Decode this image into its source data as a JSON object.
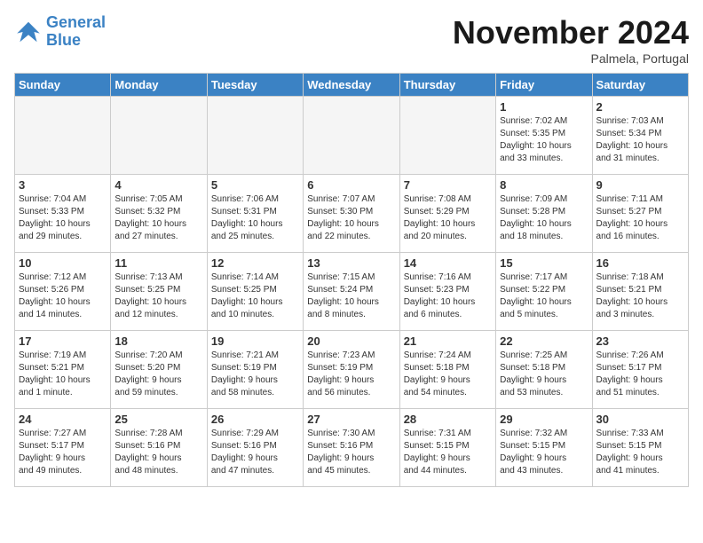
{
  "header": {
    "logo_line1": "General",
    "logo_line2": "Blue",
    "month": "November 2024",
    "location": "Palmela, Portugal"
  },
  "weekdays": [
    "Sunday",
    "Monday",
    "Tuesday",
    "Wednesday",
    "Thursday",
    "Friday",
    "Saturday"
  ],
  "weeks": [
    [
      {
        "day": "",
        "info": ""
      },
      {
        "day": "",
        "info": ""
      },
      {
        "day": "",
        "info": ""
      },
      {
        "day": "",
        "info": ""
      },
      {
        "day": "",
        "info": ""
      },
      {
        "day": "1",
        "info": "Sunrise: 7:02 AM\nSunset: 5:35 PM\nDaylight: 10 hours\nand 33 minutes."
      },
      {
        "day": "2",
        "info": "Sunrise: 7:03 AM\nSunset: 5:34 PM\nDaylight: 10 hours\nand 31 minutes."
      }
    ],
    [
      {
        "day": "3",
        "info": "Sunrise: 7:04 AM\nSunset: 5:33 PM\nDaylight: 10 hours\nand 29 minutes."
      },
      {
        "day": "4",
        "info": "Sunrise: 7:05 AM\nSunset: 5:32 PM\nDaylight: 10 hours\nand 27 minutes."
      },
      {
        "day": "5",
        "info": "Sunrise: 7:06 AM\nSunset: 5:31 PM\nDaylight: 10 hours\nand 25 minutes."
      },
      {
        "day": "6",
        "info": "Sunrise: 7:07 AM\nSunset: 5:30 PM\nDaylight: 10 hours\nand 22 minutes."
      },
      {
        "day": "7",
        "info": "Sunrise: 7:08 AM\nSunset: 5:29 PM\nDaylight: 10 hours\nand 20 minutes."
      },
      {
        "day": "8",
        "info": "Sunrise: 7:09 AM\nSunset: 5:28 PM\nDaylight: 10 hours\nand 18 minutes."
      },
      {
        "day": "9",
        "info": "Sunrise: 7:11 AM\nSunset: 5:27 PM\nDaylight: 10 hours\nand 16 minutes."
      }
    ],
    [
      {
        "day": "10",
        "info": "Sunrise: 7:12 AM\nSunset: 5:26 PM\nDaylight: 10 hours\nand 14 minutes."
      },
      {
        "day": "11",
        "info": "Sunrise: 7:13 AM\nSunset: 5:25 PM\nDaylight: 10 hours\nand 12 minutes."
      },
      {
        "day": "12",
        "info": "Sunrise: 7:14 AM\nSunset: 5:25 PM\nDaylight: 10 hours\nand 10 minutes."
      },
      {
        "day": "13",
        "info": "Sunrise: 7:15 AM\nSunset: 5:24 PM\nDaylight: 10 hours\nand 8 minutes."
      },
      {
        "day": "14",
        "info": "Sunrise: 7:16 AM\nSunset: 5:23 PM\nDaylight: 10 hours\nand 6 minutes."
      },
      {
        "day": "15",
        "info": "Sunrise: 7:17 AM\nSunset: 5:22 PM\nDaylight: 10 hours\nand 5 minutes."
      },
      {
        "day": "16",
        "info": "Sunrise: 7:18 AM\nSunset: 5:21 PM\nDaylight: 10 hours\nand 3 minutes."
      }
    ],
    [
      {
        "day": "17",
        "info": "Sunrise: 7:19 AM\nSunset: 5:21 PM\nDaylight: 10 hours\nand 1 minute."
      },
      {
        "day": "18",
        "info": "Sunrise: 7:20 AM\nSunset: 5:20 PM\nDaylight: 9 hours\nand 59 minutes."
      },
      {
        "day": "19",
        "info": "Sunrise: 7:21 AM\nSunset: 5:19 PM\nDaylight: 9 hours\nand 58 minutes."
      },
      {
        "day": "20",
        "info": "Sunrise: 7:23 AM\nSunset: 5:19 PM\nDaylight: 9 hours\nand 56 minutes."
      },
      {
        "day": "21",
        "info": "Sunrise: 7:24 AM\nSunset: 5:18 PM\nDaylight: 9 hours\nand 54 minutes."
      },
      {
        "day": "22",
        "info": "Sunrise: 7:25 AM\nSunset: 5:18 PM\nDaylight: 9 hours\nand 53 minutes."
      },
      {
        "day": "23",
        "info": "Sunrise: 7:26 AM\nSunset: 5:17 PM\nDaylight: 9 hours\nand 51 minutes."
      }
    ],
    [
      {
        "day": "24",
        "info": "Sunrise: 7:27 AM\nSunset: 5:17 PM\nDaylight: 9 hours\nand 49 minutes."
      },
      {
        "day": "25",
        "info": "Sunrise: 7:28 AM\nSunset: 5:16 PM\nDaylight: 9 hours\nand 48 minutes."
      },
      {
        "day": "26",
        "info": "Sunrise: 7:29 AM\nSunset: 5:16 PM\nDaylight: 9 hours\nand 47 minutes."
      },
      {
        "day": "27",
        "info": "Sunrise: 7:30 AM\nSunset: 5:16 PM\nDaylight: 9 hours\nand 45 minutes."
      },
      {
        "day": "28",
        "info": "Sunrise: 7:31 AM\nSunset: 5:15 PM\nDaylight: 9 hours\nand 44 minutes."
      },
      {
        "day": "29",
        "info": "Sunrise: 7:32 AM\nSunset: 5:15 PM\nDaylight: 9 hours\nand 43 minutes."
      },
      {
        "day": "30",
        "info": "Sunrise: 7:33 AM\nSunset: 5:15 PM\nDaylight: 9 hours\nand 41 minutes."
      }
    ]
  ]
}
